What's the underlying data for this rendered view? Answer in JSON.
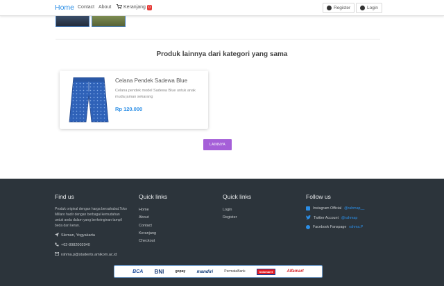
{
  "navbar": {
    "brand": "Home",
    "links": [
      "Contact",
      "About"
    ],
    "cart_label": "Keranjang",
    "cart_count": "0",
    "register_label": "Register",
    "login_label": "Login"
  },
  "related": {
    "title": "Produk lainnya dari kategori yang sama",
    "product": {
      "name": "Celana Pendek Sadewa Blue",
      "description": "Celana pendek model Sadewa Blue untuk anak muda jaman sekarang",
      "price": "Rp 120.000"
    },
    "more_label": "LAINNYA"
  },
  "footer": {
    "find_us": {
      "title": "Find us",
      "text": "Produk original dengan harga bersahabat.Toko Millaro hadir dengan berbagai kemudahan untuk anda dalam yang berkeinginan tampil beda dari keran.",
      "location": "Sleman, Yogyakarta",
      "phone": "+62-8982002040",
      "email": "rahma.p@students.amikom.ac.id"
    },
    "quick_links_1": {
      "title": "Quick links",
      "items": [
        "Home",
        "About",
        "Contact",
        "Keranjang",
        "Checkout"
      ]
    },
    "quick_links_2": {
      "title": "Quick links",
      "items": [
        "Login",
        "Register"
      ]
    },
    "follow_us": {
      "title": "Follow us",
      "instagram_label": "Instagram Official",
      "instagram_handle": "@rahmap__",
      "twitter_label": "Twitter Account",
      "twitter_handle": "@rahmap",
      "facebook_label": "Facebook Fanspage",
      "facebook_handle": "rahma.P"
    },
    "payments": [
      "BCA",
      "BNI",
      "gopay",
      "mandiri",
      "PermataBank",
      "Indomaret",
      "Alfamart"
    ]
  },
  "colors": {
    "accent": "#2b8ee6",
    "button": "#a55fd8",
    "footer_bg": "#2c343b",
    "badge": "#e53935"
  }
}
